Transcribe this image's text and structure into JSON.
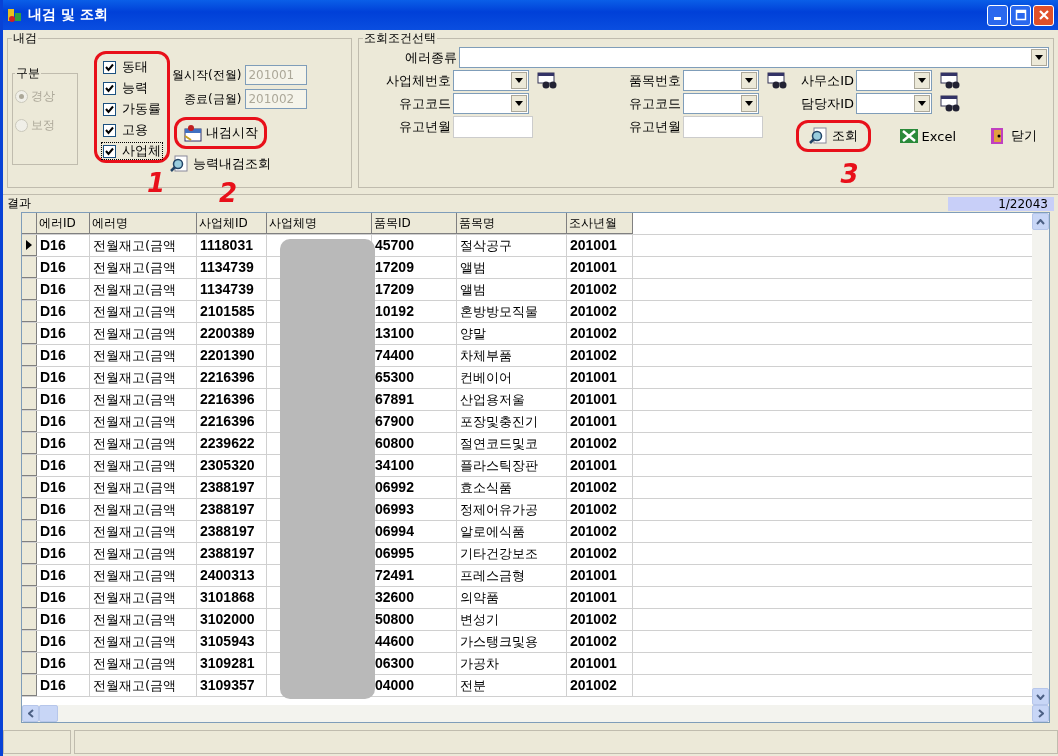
{
  "window": {
    "title": "내검 및 조회"
  },
  "check_group": {
    "title": "내검",
    "division": {
      "title": "구분",
      "options": [
        {
          "label": "경상",
          "selected": true,
          "disabled": true
        },
        {
          "label": "보정",
          "selected": false,
          "disabled": true
        }
      ]
    },
    "checks": [
      {
        "label": "동태",
        "checked": true,
        "focused": false
      },
      {
        "label": "능력",
        "checked": true,
        "focused": false
      },
      {
        "label": "가동률",
        "checked": true,
        "focused": false
      },
      {
        "label": "고용",
        "checked": true,
        "focused": false
      },
      {
        "label": "사업체",
        "checked": true,
        "focused": true
      }
    ],
    "start": {
      "label": "월시작(전월)",
      "value": "201001",
      "disabled": true
    },
    "end": {
      "label": "종료(금월)",
      "value": "201002",
      "disabled": true
    },
    "run_button": "내검시작",
    "ability_button": "능력내검조회"
  },
  "query": {
    "title": "조회조건선택",
    "error_type": {
      "label": "에러종류"
    },
    "fields": [
      {
        "label": "사업체번호",
        "kind": "combo-search"
      },
      {
        "label": "품목번호",
        "kind": "combo-search"
      },
      {
        "label": "사무소ID",
        "kind": "combo-search"
      },
      {
        "label": "유고코드",
        "kind": "combo"
      },
      {
        "label": "유고코드",
        "kind": "combo"
      },
      {
        "label": "담당자ID",
        "kind": "combo-search"
      },
      {
        "label": "유고년월",
        "kind": "text"
      },
      {
        "label": "유고년월",
        "kind": "text"
      }
    ],
    "buttons": [
      {
        "label": "조회",
        "kind": "search"
      },
      {
        "label": "Excel",
        "kind": "excel"
      },
      {
        "label": "닫기",
        "kind": "close"
      }
    ]
  },
  "result": {
    "title": "결과",
    "count": "1/22043"
  },
  "table": {
    "columns": [
      "에러ID",
      "에러명",
      "사업체ID",
      "사업체명",
      "품목ID",
      "품목명",
      "조사년월"
    ],
    "rows": [
      {
        "current": true,
        "cells": [
          "D16",
          "전월재고(금액",
          "1118031",
          "",
          "45700",
          "절삭공구",
          "201001"
        ]
      },
      {
        "current": false,
        "cells": [
          "D16",
          "전월재고(금액",
          "1134739",
          "",
          "17209",
          "앨범",
          "201001"
        ]
      },
      {
        "current": false,
        "cells": [
          "D16",
          "전월재고(금액",
          "1134739",
          "",
          "17209",
          "앨범",
          "201002"
        ]
      },
      {
        "current": false,
        "cells": [
          "D16",
          "전월재고(금액",
          "2101585",
          "",
          "10192",
          "혼방방모직물",
          "201002"
        ]
      },
      {
        "current": false,
        "cells": [
          "D16",
          "전월재고(금액",
          "2200389",
          "",
          "13100",
          "양말",
          "201002"
        ]
      },
      {
        "current": false,
        "cells": [
          "D16",
          "전월재고(금액",
          "2201390",
          "",
          "74400",
          "차체부품",
          "201002"
        ]
      },
      {
        "current": false,
        "cells": [
          "D16",
          "전월재고(금액",
          "2216396",
          "",
          "65300",
          "컨베이어",
          "201001"
        ]
      },
      {
        "current": false,
        "cells": [
          "D16",
          "전월재고(금액",
          "2216396",
          "",
          "67891",
          "산업용저울",
          "201001"
        ]
      },
      {
        "current": false,
        "cells": [
          "D16",
          "전월재고(금액",
          "2216396",
          "",
          "67900",
          "포장및충진기",
          "201001"
        ]
      },
      {
        "current": false,
        "cells": [
          "D16",
          "전월재고(금액",
          "2239622",
          "",
          "60800",
          "절연코드및코",
          "201002"
        ]
      },
      {
        "current": false,
        "cells": [
          "D16",
          "전월재고(금액",
          "2305320",
          "",
          "34100",
          "플라스틱장판",
          "201001"
        ]
      },
      {
        "current": false,
        "cells": [
          "D16",
          "전월재고(금액",
          "2388197",
          "",
          "06992",
          "효소식품",
          "201002"
        ]
      },
      {
        "current": false,
        "cells": [
          "D16",
          "전월재고(금액",
          "2388197",
          "",
          "06993",
          "정제어유가공",
          "201002"
        ]
      },
      {
        "current": false,
        "cells": [
          "D16",
          "전월재고(금액",
          "2388197",
          "",
          "06994",
          "알로에식품",
          "201002"
        ]
      },
      {
        "current": false,
        "cells": [
          "D16",
          "전월재고(금액",
          "2388197",
          "",
          "06995",
          "기타건강보조",
          "201002"
        ]
      },
      {
        "current": false,
        "cells": [
          "D16",
          "전월재고(금액",
          "2400313",
          "",
          "72491",
          "프레스금형",
          "201001"
        ]
      },
      {
        "current": false,
        "cells": [
          "D16",
          "전월재고(금액",
          "3101868",
          "",
          "32600",
          "의약품",
          "201001"
        ]
      },
      {
        "current": false,
        "cells": [
          "D16",
          "전월재고(금액",
          "3102000",
          "",
          "50800",
          "변성기",
          "201002"
        ]
      },
      {
        "current": false,
        "cells": [
          "D16",
          "전월재고(금액",
          "3105943",
          "",
          "44600",
          "가스탱크및용",
          "201002"
        ]
      },
      {
        "current": false,
        "cells": [
          "D16",
          "전월재고(금액",
          "3109281",
          "",
          "06300",
          "가공차",
          "201001"
        ]
      },
      {
        "current": false,
        "cells": [
          "D16",
          "전월재고(금액",
          "3109357",
          "",
          "04000",
          "전분",
          "201002"
        ]
      }
    ]
  },
  "annotations": [
    "1",
    "2",
    "3"
  ]
}
